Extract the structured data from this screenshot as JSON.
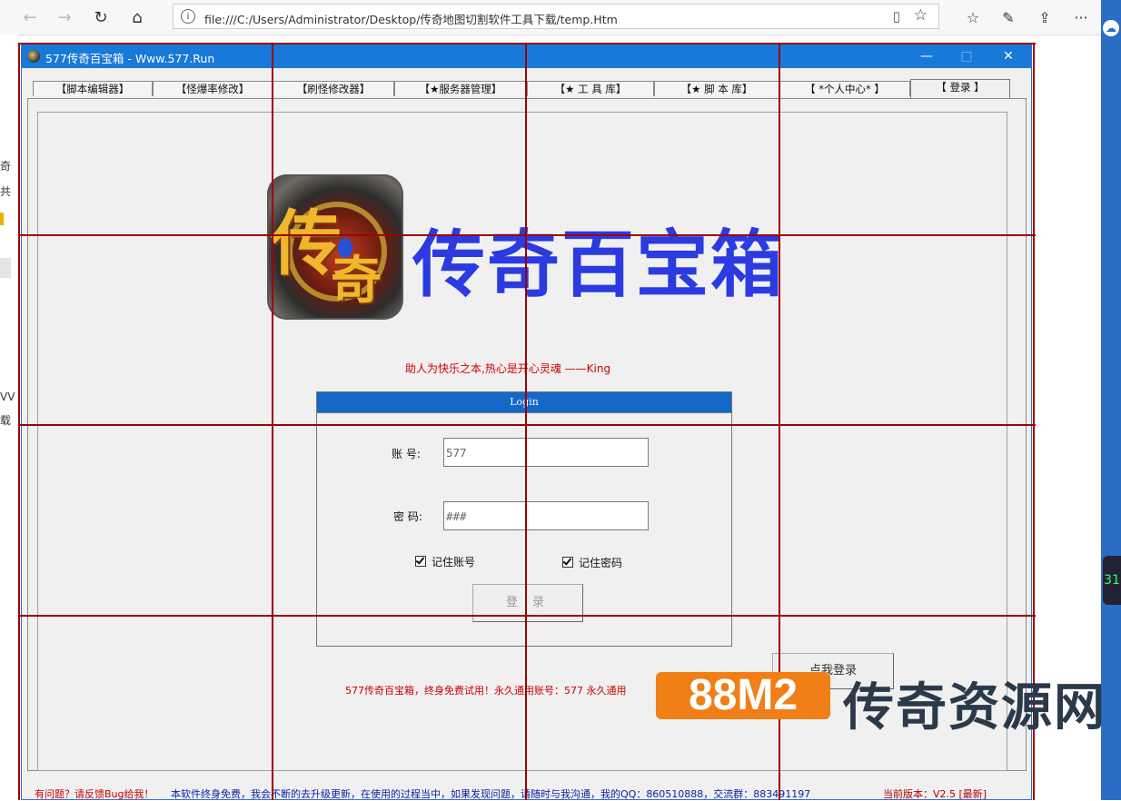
{
  "browser": {
    "back_icon": "←",
    "forward_icon": "→",
    "refresh_icon": "↻",
    "home_icon": "⌂",
    "url": "file:///C:/Users/Administrator/Desktop/传奇地图切割软件工具下载/temp.Htm",
    "tools": [
      "☆",
      "✎",
      "⇪",
      "···"
    ]
  },
  "left_strip": [
    "奇",
    "共",
    "ⅤⅤ",
    "载"
  ],
  "desktop_right": {
    "widget": "31"
  },
  "app": {
    "title": "577传奇百宝箱 - Www.577.Run",
    "controls": {
      "minimize": "—",
      "maximize": "□",
      "close": "✕"
    },
    "tabs": [
      "【脚本编辑器】",
      "【怪爆率修改】",
      "【刷怪修改器】",
      "【★服务器管理】",
      "【★ 工 具 库】",
      "【★ 脚 本 库】",
      "【 *个人中心* 】",
      "【 登录 】"
    ],
    "logo": {
      "g1": "传",
      "g2": "奇"
    },
    "brand": "传奇百宝箱",
    "slogan": "助人为快乐之本,热心是开心灵魂   ——King",
    "login": {
      "header": "Login",
      "account_label": "账 号:",
      "account_value": "577",
      "password_label": "密 码:",
      "password_value": "###",
      "remember_account": "记住账号",
      "remember_password": "记住密码",
      "submit": "登 录"
    },
    "side_button": "点我登录",
    "free_note": "577传奇百宝箱，终身免费试用！永久通用账号：577   永久通用",
    "status": {
      "question": "有问题？请反馈Bug给我！",
      "message": "本软件终身免费，我会不断的去升级更新，在使用的过程当中，如果发现问题，请随时与我沟通，我的QQ：860510888，交流群：883491197",
      "version": "当前版本：V2.5 [最新]"
    }
  },
  "watermark": {
    "badge": "88M2",
    "text": "传奇资源网"
  },
  "colors": {
    "titlebar": "#1979d8",
    "brand": "#2b3be0",
    "accent_red": "#cc0000",
    "watermark_orange": "#f07f17"
  }
}
